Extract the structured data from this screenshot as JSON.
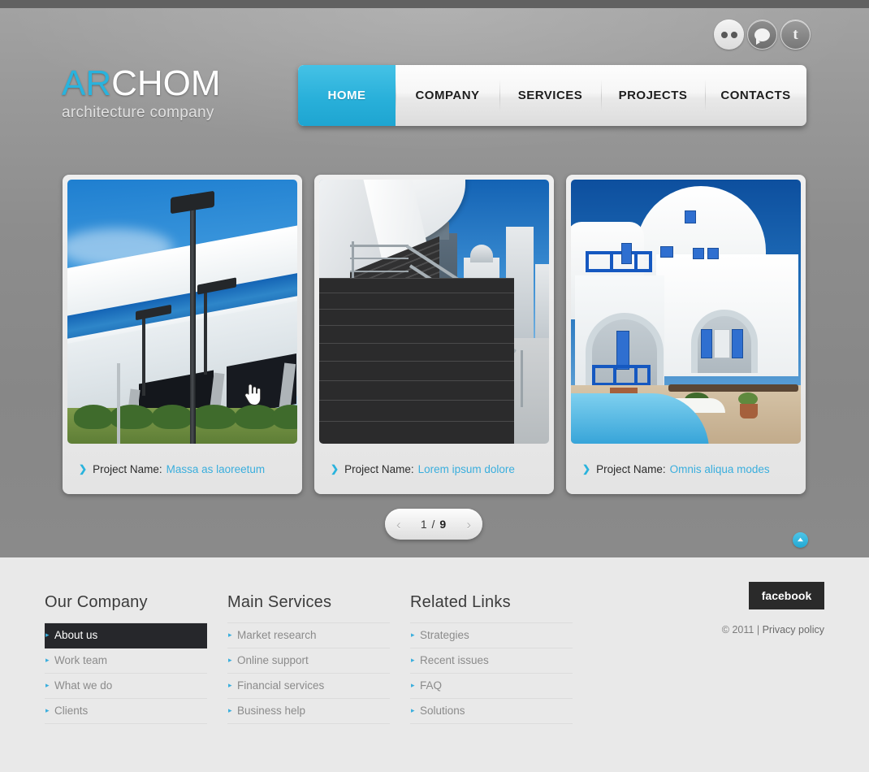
{
  "site": {
    "logo_accent": "AR",
    "logo_rest": "CHOM",
    "tagline": "architecture company",
    "accent_color": "#29b3dd",
    "dark_color": "#26272b"
  },
  "social": [
    {
      "name": "flickr-icon",
      "label": "Flickr"
    },
    {
      "name": "chat-icon",
      "label": "Chat"
    },
    {
      "name": "twitter-icon",
      "label": "t"
    }
  ],
  "nav": {
    "items": [
      {
        "label": "HOME",
        "active": true
      },
      {
        "label": "COMPANY",
        "active": false
      },
      {
        "label": "SERVICES",
        "active": false
      },
      {
        "label": "PROJECTS",
        "active": false
      },
      {
        "label": "CONTACTS",
        "active": false
      }
    ]
  },
  "portfolio": {
    "caption_prefix": "Project Name:",
    "cards": [
      {
        "title": "Massa as laoreetum",
        "image_alt": "modern white and blue office building with lamppost"
      },
      {
        "title": "Lorem ipsum dolore",
        "image_alt": "dark granite stairs with metal railing and city skyline"
      },
      {
        "title": "Omnis aliqua modes",
        "image_alt": "white mediterranean villa with blue shutters and pool"
      }
    ]
  },
  "pager": {
    "prev": "‹",
    "next": "›",
    "current": "1",
    "separator": "/",
    "total": "9",
    "display": "1 / 9"
  },
  "to_top": {
    "label": "back-to-top"
  },
  "footer": {
    "columns": [
      {
        "title": "Our Company",
        "items": [
          {
            "label": "About us",
            "active": true
          },
          {
            "label": "Work team",
            "active": false
          },
          {
            "label": "What we do",
            "active": false
          },
          {
            "label": "Clients",
            "active": false
          }
        ]
      },
      {
        "title": "Main Services",
        "items": [
          {
            "label": "Market research",
            "active": false
          },
          {
            "label": "Online support",
            "active": false
          },
          {
            "label": "Financial services",
            "active": false
          },
          {
            "label": "Business help",
            "active": false
          }
        ]
      },
      {
        "title": "Related Links",
        "items": [
          {
            "label": "Strategies",
            "active": false
          },
          {
            "label": "Recent issues",
            "active": false
          },
          {
            "label": "FAQ",
            "active": false
          },
          {
            "label": "Solutions",
            "active": false
          }
        ]
      }
    ],
    "facebook_label": "facebook",
    "copyright": "© 2011 |",
    "privacy_label": "Privacy policy"
  }
}
